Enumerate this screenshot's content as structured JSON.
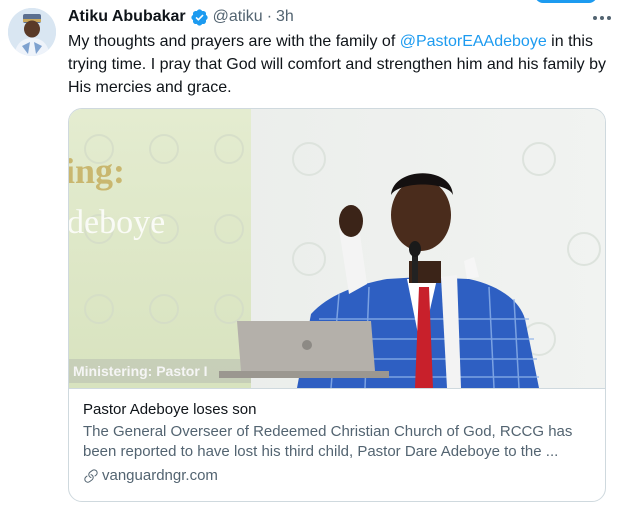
{
  "tweet": {
    "author_name": "Atiku Abubakar",
    "handle": "@atiku",
    "separator": "·",
    "time": "3h",
    "text_before": "My thoughts and prayers are with the family of ",
    "mention": "@PastorEAAdeboye",
    "text_after": " in this trying time. I pray that God will comfort and strengthen him and his family by His mercies and grace."
  },
  "icons": {
    "verified": "verified-badge-icon",
    "more": "more-options-icon",
    "link": "link-icon"
  },
  "card": {
    "image_overlay_top": "ing:",
    "image_overlay_name": "deboye",
    "image_caption": "Ministering: Pastor I",
    "title": "Pastor Adeboye loses son",
    "description": "The General Overseer of Redeemed Christian Church of God, RCCG has been reported to have lost his third child, Pastor Dare Adeboye to the ...",
    "domain": "vanguardngr.com"
  },
  "colors": {
    "accent": "#1d9bf0",
    "text": "#0f1419",
    "secondary": "#536471",
    "border": "#cfd9de"
  }
}
